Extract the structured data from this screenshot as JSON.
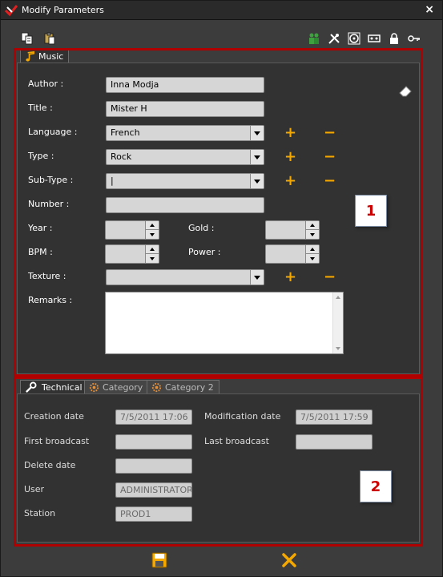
{
  "window": {
    "title": "Modify Parameters",
    "close_label": "×"
  },
  "toolbar": {
    "left_icons": [
      "copy-icon",
      "paste-icon"
    ],
    "right_icons": [
      "people-icon",
      "tools-icon",
      "disc-icon",
      "tape-icon",
      "lock-icon",
      "key-icon"
    ]
  },
  "top_panel": {
    "tab_label": "Music",
    "fields": {
      "author_label": "Author :",
      "author_value": "Inna Modja",
      "title_label": "Title :",
      "title_value": "Mister H",
      "language_label": "Language :",
      "language_value": "French",
      "type_label": "Type :",
      "type_value": "Rock",
      "subtype_label": "Sub-Type :",
      "subtype_value": "|",
      "number_label": "Number :",
      "number_value": "",
      "year_label": "Year :",
      "gold_label": "Gold :",
      "bpm_label": "BPM :",
      "power_label": "Power :",
      "texture_label": "Texture :",
      "texture_value": "",
      "remarks_label": "Remarks :"
    },
    "plus": "+",
    "minus": "−",
    "callout": "1"
  },
  "bottom_panel": {
    "tabs": [
      "Technical",
      "Category",
      "Category 2"
    ],
    "fields": {
      "creation_label": "Creation date",
      "creation_value": "7/5/2011 17:06",
      "modification_label": "Modification date",
      "modification_value": "7/5/2011 17:59",
      "first_broadcast_label": "First broadcast",
      "first_broadcast_value": "",
      "last_broadcast_label": "Last broadcast",
      "last_broadcast_value": "",
      "delete_label": "Delete date",
      "delete_value": "",
      "user_label": "User",
      "user_value": "ADMINISTRATOR",
      "station_label": "Station",
      "station_value": "PROD1"
    },
    "callout": "2"
  },
  "colors": {
    "accent": "#f5a800",
    "highlight_box": "#b00000",
    "callout_text": "#cc0000"
  }
}
